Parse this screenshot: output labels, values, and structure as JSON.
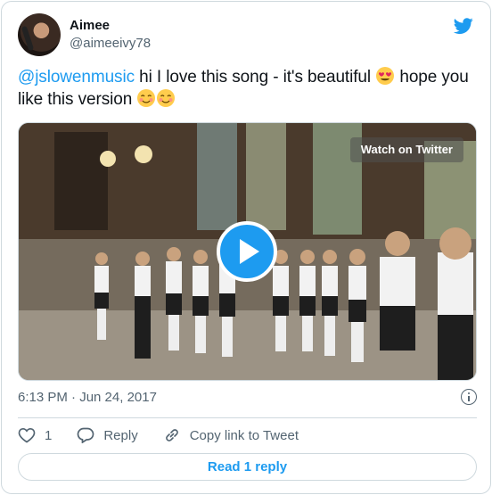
{
  "tweet": {
    "author": {
      "display_name": "Aimee",
      "handle": "@aimeeivy78"
    },
    "text": {
      "mention": "@jslowenmusic",
      "part1": " hi I love this song - it's beautiful ",
      "part2": " hope you like this version "
    },
    "media": {
      "overlay_label": "Watch on Twitter"
    },
    "timestamp": "6:13 PM · Jun 24, 2017",
    "actions": {
      "like_count": "1",
      "reply_label": "Reply",
      "copy_link_label": "Copy link to Tweet"
    },
    "read_replies_label": "Read 1 reply"
  },
  "colors": {
    "accent": "#1d9bf0",
    "text": "#0f1419",
    "muted": "#536471",
    "border": "#cfd9de"
  },
  "icons": [
    "twitter-bird-icon",
    "heart-eyes-emoji",
    "smiling-face-emoji",
    "play-icon",
    "info-icon",
    "heart-icon",
    "reply-icon",
    "link-icon"
  ]
}
